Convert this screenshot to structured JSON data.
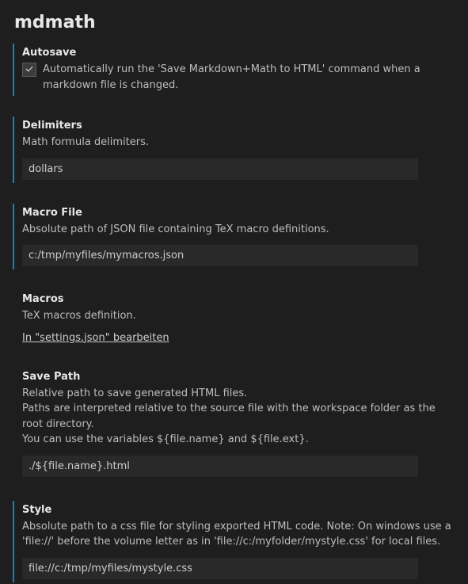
{
  "heading": "mdmath",
  "autosave": {
    "label": "Autosave",
    "description": "Automatically run the 'Save Markdown+Math to HTML' command when a markdown file is changed.",
    "checked": true
  },
  "delimiters": {
    "label": "Delimiters",
    "description": "Math formula delimiters.",
    "value": "dollars"
  },
  "macroFile": {
    "label": "Macro File",
    "description": "Absolute path of JSON file containing TeX macro definitions.",
    "value": "c:/tmp/myfiles/mymacros.json"
  },
  "macros": {
    "label": "Macros",
    "description": "TeX macros definition.",
    "editLink": "In \"settings.json\" bearbeiten"
  },
  "savePath": {
    "label": "Save Path",
    "descLine1": "Relative path to save generated HTML files.",
    "descLine2": "Paths are interpreted relative to the source file with the workspace folder as the root directory.",
    "descLine3": "You can use the variables ${file.name} and ${file.ext}.",
    "value": "./${file.name}.html"
  },
  "style": {
    "label": "Style",
    "description": "Absolute path to a css file for styling exported HTML code. Note: On windows use a 'file://' before the volume letter as in 'file://c:/myfolder/mystyle.css' for local files.",
    "value": "file://c:/tmp/myfiles/mystyle.css"
  }
}
